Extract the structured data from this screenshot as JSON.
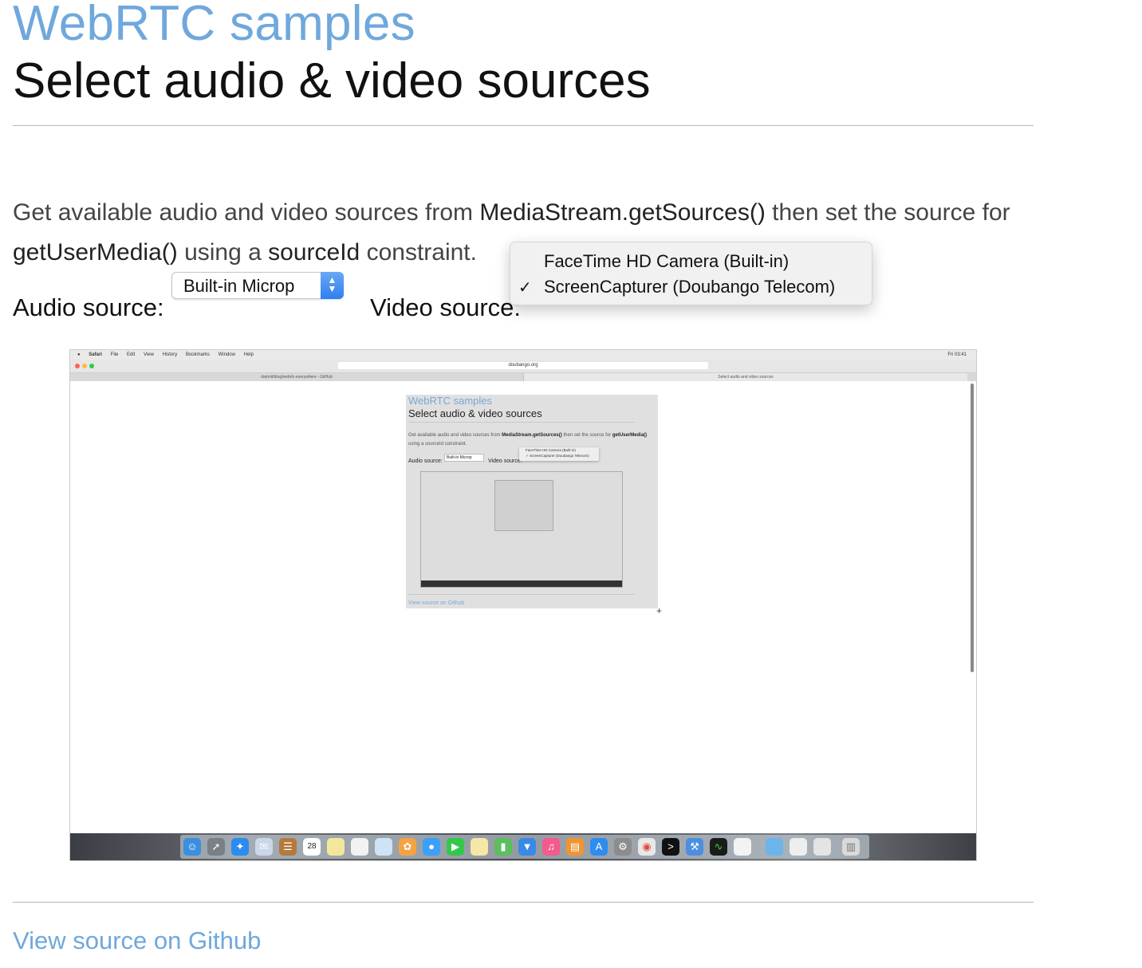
{
  "header": {
    "site_title": "WebRTC samples",
    "page_title": "Select audio & video sources"
  },
  "intro": {
    "text1": "Get available audio and video sources from ",
    "code1": "MediaStream.getSources()",
    "text2": " then set the source for ",
    "code2": "getUserMedia()",
    "text3": " using a ",
    "code3": "sourceId",
    "text4": " constraint."
  },
  "audio": {
    "label": "Audio source:",
    "selected": "Built-in Microp"
  },
  "video": {
    "label": "Video source:",
    "options": [
      {
        "label": "FaceTime HD Camera (Built-in)",
        "checked": false
      },
      {
        "label": "ScreenCapturer (Doubango Telecom)",
        "checked": true
      }
    ],
    "check_glyph": "✓"
  },
  "screen": {
    "menubar": [
      "Safari",
      "File",
      "Edit",
      "View",
      "History",
      "Bookmarks",
      "Window",
      "Help"
    ],
    "clock": "Fri 03:41",
    "url": "doubango.org",
    "tab_left": "damnit/blog/webrtc-everywhere - GitHub",
    "tab_right": "Select audio and video sources",
    "inner_site_title": "WebRTC samples",
    "inner_page_title": "Select audio & video sources",
    "inner_desc1": "Get available audio and video sources from ",
    "inner_code1": "MediaStream.getSources()",
    "inner_desc2": " then set the source for ",
    "inner_code2": "getUserMedia()",
    "inner_desc3": " using a sourceId constraint.",
    "inner_audio_label": "Audio source:",
    "inner_audio_value": "Built-in Microp",
    "inner_video_label": "Video source:",
    "inner_option1": "FaceTime HD Camera (Built-in)",
    "inner_option2": "✓ ScreenCapturer (Doubango Telecom)",
    "inner_footer": "View source on Github",
    "calendar_day": "28"
  },
  "footer": {
    "link": "View source on Github"
  },
  "colors": {
    "accent": "#6fa8dc",
    "select_arrow": "#2d7ff0"
  }
}
